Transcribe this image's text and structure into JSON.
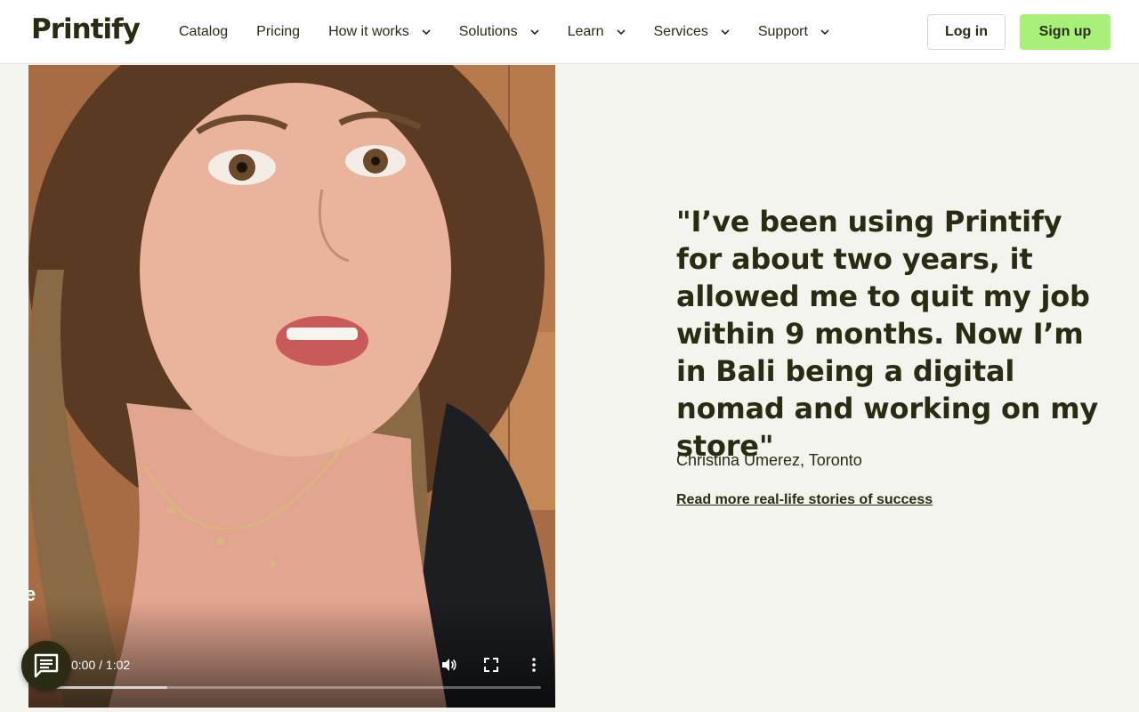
{
  "brand": {
    "name": "Printify"
  },
  "nav": {
    "items": [
      {
        "label": "Catalog",
        "dropdown": false
      },
      {
        "label": "Pricing",
        "dropdown": false
      },
      {
        "label": "How it works",
        "dropdown": true
      },
      {
        "label": "Solutions",
        "dropdown": true
      },
      {
        "label": "Learn",
        "dropdown": true
      },
      {
        "label": "Services",
        "dropdown": true
      },
      {
        "label": "Support",
        "dropdown": true
      }
    ],
    "login_label": "Log in",
    "signup_label": "Sign up"
  },
  "video": {
    "time": "0:00 / 1:02",
    "buffered_fraction": 0.25,
    "edge_text": "e"
  },
  "testimonial": {
    "quote": "\"I’ve been using Printify for about two years, it allowed me to quit my job within 9 months. Now I’m in Bali being a digital nomad and working on my store\"",
    "author": "Christina Umerez, Toronto",
    "link_label": "Read more real-life stories of success"
  },
  "colors": {
    "accent": "#a8f07a",
    "text": "#2a2b12",
    "background": "#f4f4ef"
  },
  "icons": [
    "chevron-down-icon",
    "volume-icon",
    "fullscreen-icon",
    "more-options-icon",
    "chat-icon"
  ]
}
